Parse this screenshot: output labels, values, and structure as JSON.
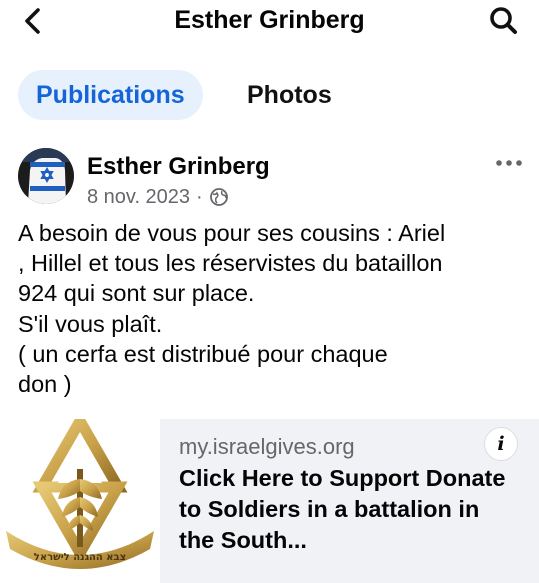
{
  "header": {
    "title": "Esther Grinberg",
    "back_icon": "chevron-left-icon",
    "search_icon": "search-icon"
  },
  "tabs": [
    {
      "label": "Publications",
      "active": true
    },
    {
      "label": "Photos",
      "active": false
    }
  ],
  "post": {
    "author": "Esther Grinberg",
    "date": "8 nov. 2023",
    "separator": "·",
    "audience_icon": "globe-icon",
    "more_icon": "more-horizontal-icon",
    "text": "A besoin de vous pour ses cousins : Ariel\n, Hillel et tous les réservistes du bataillon\n924 qui sont sur place.\nS'il vous plaît.\n( un cerfa est distribué pour chaque\ndon )"
  },
  "ad": {
    "domain": "my.israelgives.org",
    "headline": "Click Here to Support Donate to Soldiers in a battalion in the South...",
    "info_label": "i",
    "image_caption": "צבא ההגנה לישראל"
  },
  "colors": {
    "accent": "#1565d8",
    "tab_active_bg": "#e7f1fd",
    "secondary_text": "#65676b",
    "ad_bg": "#f0f2f5",
    "emblem_gold": "#c9a24a"
  }
}
